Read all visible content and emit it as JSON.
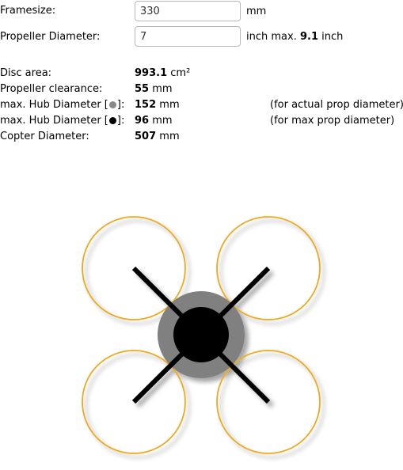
{
  "inputs": {
    "framesize": {
      "label": "Framesize:",
      "value": "330",
      "unit": "mm"
    },
    "prop_diameter": {
      "label": "Propeller Diameter:",
      "value": "7",
      "unit": "inch",
      "max_label": "max.",
      "max_value": "9.1",
      "max_unit": "inch"
    }
  },
  "results": {
    "disc_area": {
      "label": "Disc area:",
      "value": "993.1",
      "unit": "cm²"
    },
    "prop_clearance": {
      "label": "Propeller clearance:",
      "value": "55",
      "unit": "mm"
    },
    "hub_actual": {
      "label_prefix": "max. Hub Diameter [",
      "label_suffix": "]:",
      "value": "152",
      "unit": "mm",
      "note": "(for actual prop diameter)",
      "dot_color": "#8a8a8a"
    },
    "hub_max": {
      "label_prefix": "max. Hub Diameter [",
      "label_suffix": "]:",
      "value": "96",
      "unit": "mm",
      "note": "(for max prop diameter)",
      "dot_color": "#000000"
    },
    "copter_diameter": {
      "label": "Copter Diameter:",
      "value": "507",
      "unit": "mm"
    }
  },
  "diagram": {
    "prop_color": "#f0a81c",
    "arm_color": "#000000",
    "hub_actual_color": "#808080",
    "hub_max_color": "#000000"
  }
}
